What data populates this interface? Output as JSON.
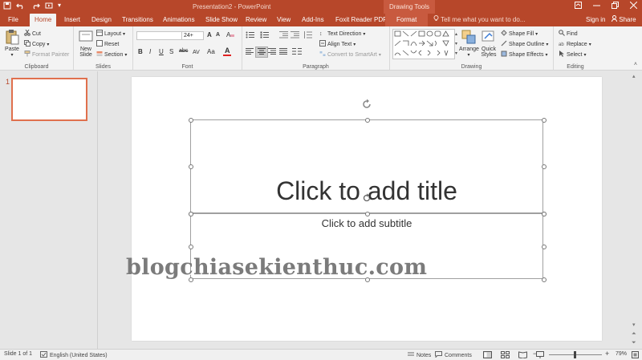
{
  "window": {
    "title": "Presentation2 - PowerPoint",
    "context_tab_group": "Drawing Tools"
  },
  "tabs": [
    "File",
    "Home",
    "Insert",
    "Design",
    "Transitions",
    "Animations",
    "Slide Show",
    "Review",
    "View",
    "Add-Ins",
    "Foxit Reader PDF",
    "Format"
  ],
  "active_tab": "Home",
  "tell_me": "Tell me what you want to do...",
  "sign_in": "Sign in",
  "share": "Share",
  "ribbon": {
    "clipboard": {
      "label": "Clipboard",
      "paste": "Paste",
      "cut": "Cut",
      "copy": "Copy",
      "format_painter": "Format Painter"
    },
    "slides": {
      "label": "Slides",
      "new_slide": "New Slide",
      "layout": "Layout",
      "reset": "Reset",
      "section": "Section"
    },
    "font": {
      "label": "Font",
      "font_name": "",
      "font_size": "24+",
      "bold": "B",
      "italic": "I",
      "underline": "U",
      "strike": "S",
      "spacing": "abc",
      "case": "Aa",
      "font_color_letter": "A",
      "grow": "A",
      "shrink": "A"
    },
    "paragraph": {
      "label": "Paragraph",
      "text_direction": "Text Direction",
      "align_text": "Align Text",
      "smartart": "Convert to SmartArt"
    },
    "drawing": {
      "label": "Drawing",
      "arrange": "Arrange",
      "quick_styles": "Quick Styles",
      "shape_fill": "Shape Fill",
      "shape_outline": "Shape Outline",
      "shape_effects": "Shape Effects"
    },
    "editing": {
      "label": "Editing",
      "find": "Find",
      "replace": "Replace",
      "select": "Select"
    }
  },
  "thumbnails": [
    {
      "number": "1"
    }
  ],
  "slide": {
    "title_placeholder": "Click to add title",
    "subtitle_placeholder": "Click to add subtitle",
    "watermark": "blogchiasekienthuc.com"
  },
  "status": {
    "slide": "Slide 1 of 1",
    "language": "English (United States)",
    "notes": "Notes",
    "comments": "Comments",
    "zoom": "79%"
  },
  "colors": {
    "accent": "#b7472a",
    "ribbon_bg": "#f3f3f3",
    "canvas_bg": "#e6e6e6",
    "thumb_border": "#e0704d",
    "font_color_bar": "#e02020"
  },
  "icons": {
    "save": "save-icon",
    "undo": "undo-icon",
    "redo": "redo-icon",
    "rotate": "rotate-handle-icon",
    "lightbulb": "lightbulb-icon",
    "user": "user-icon"
  }
}
